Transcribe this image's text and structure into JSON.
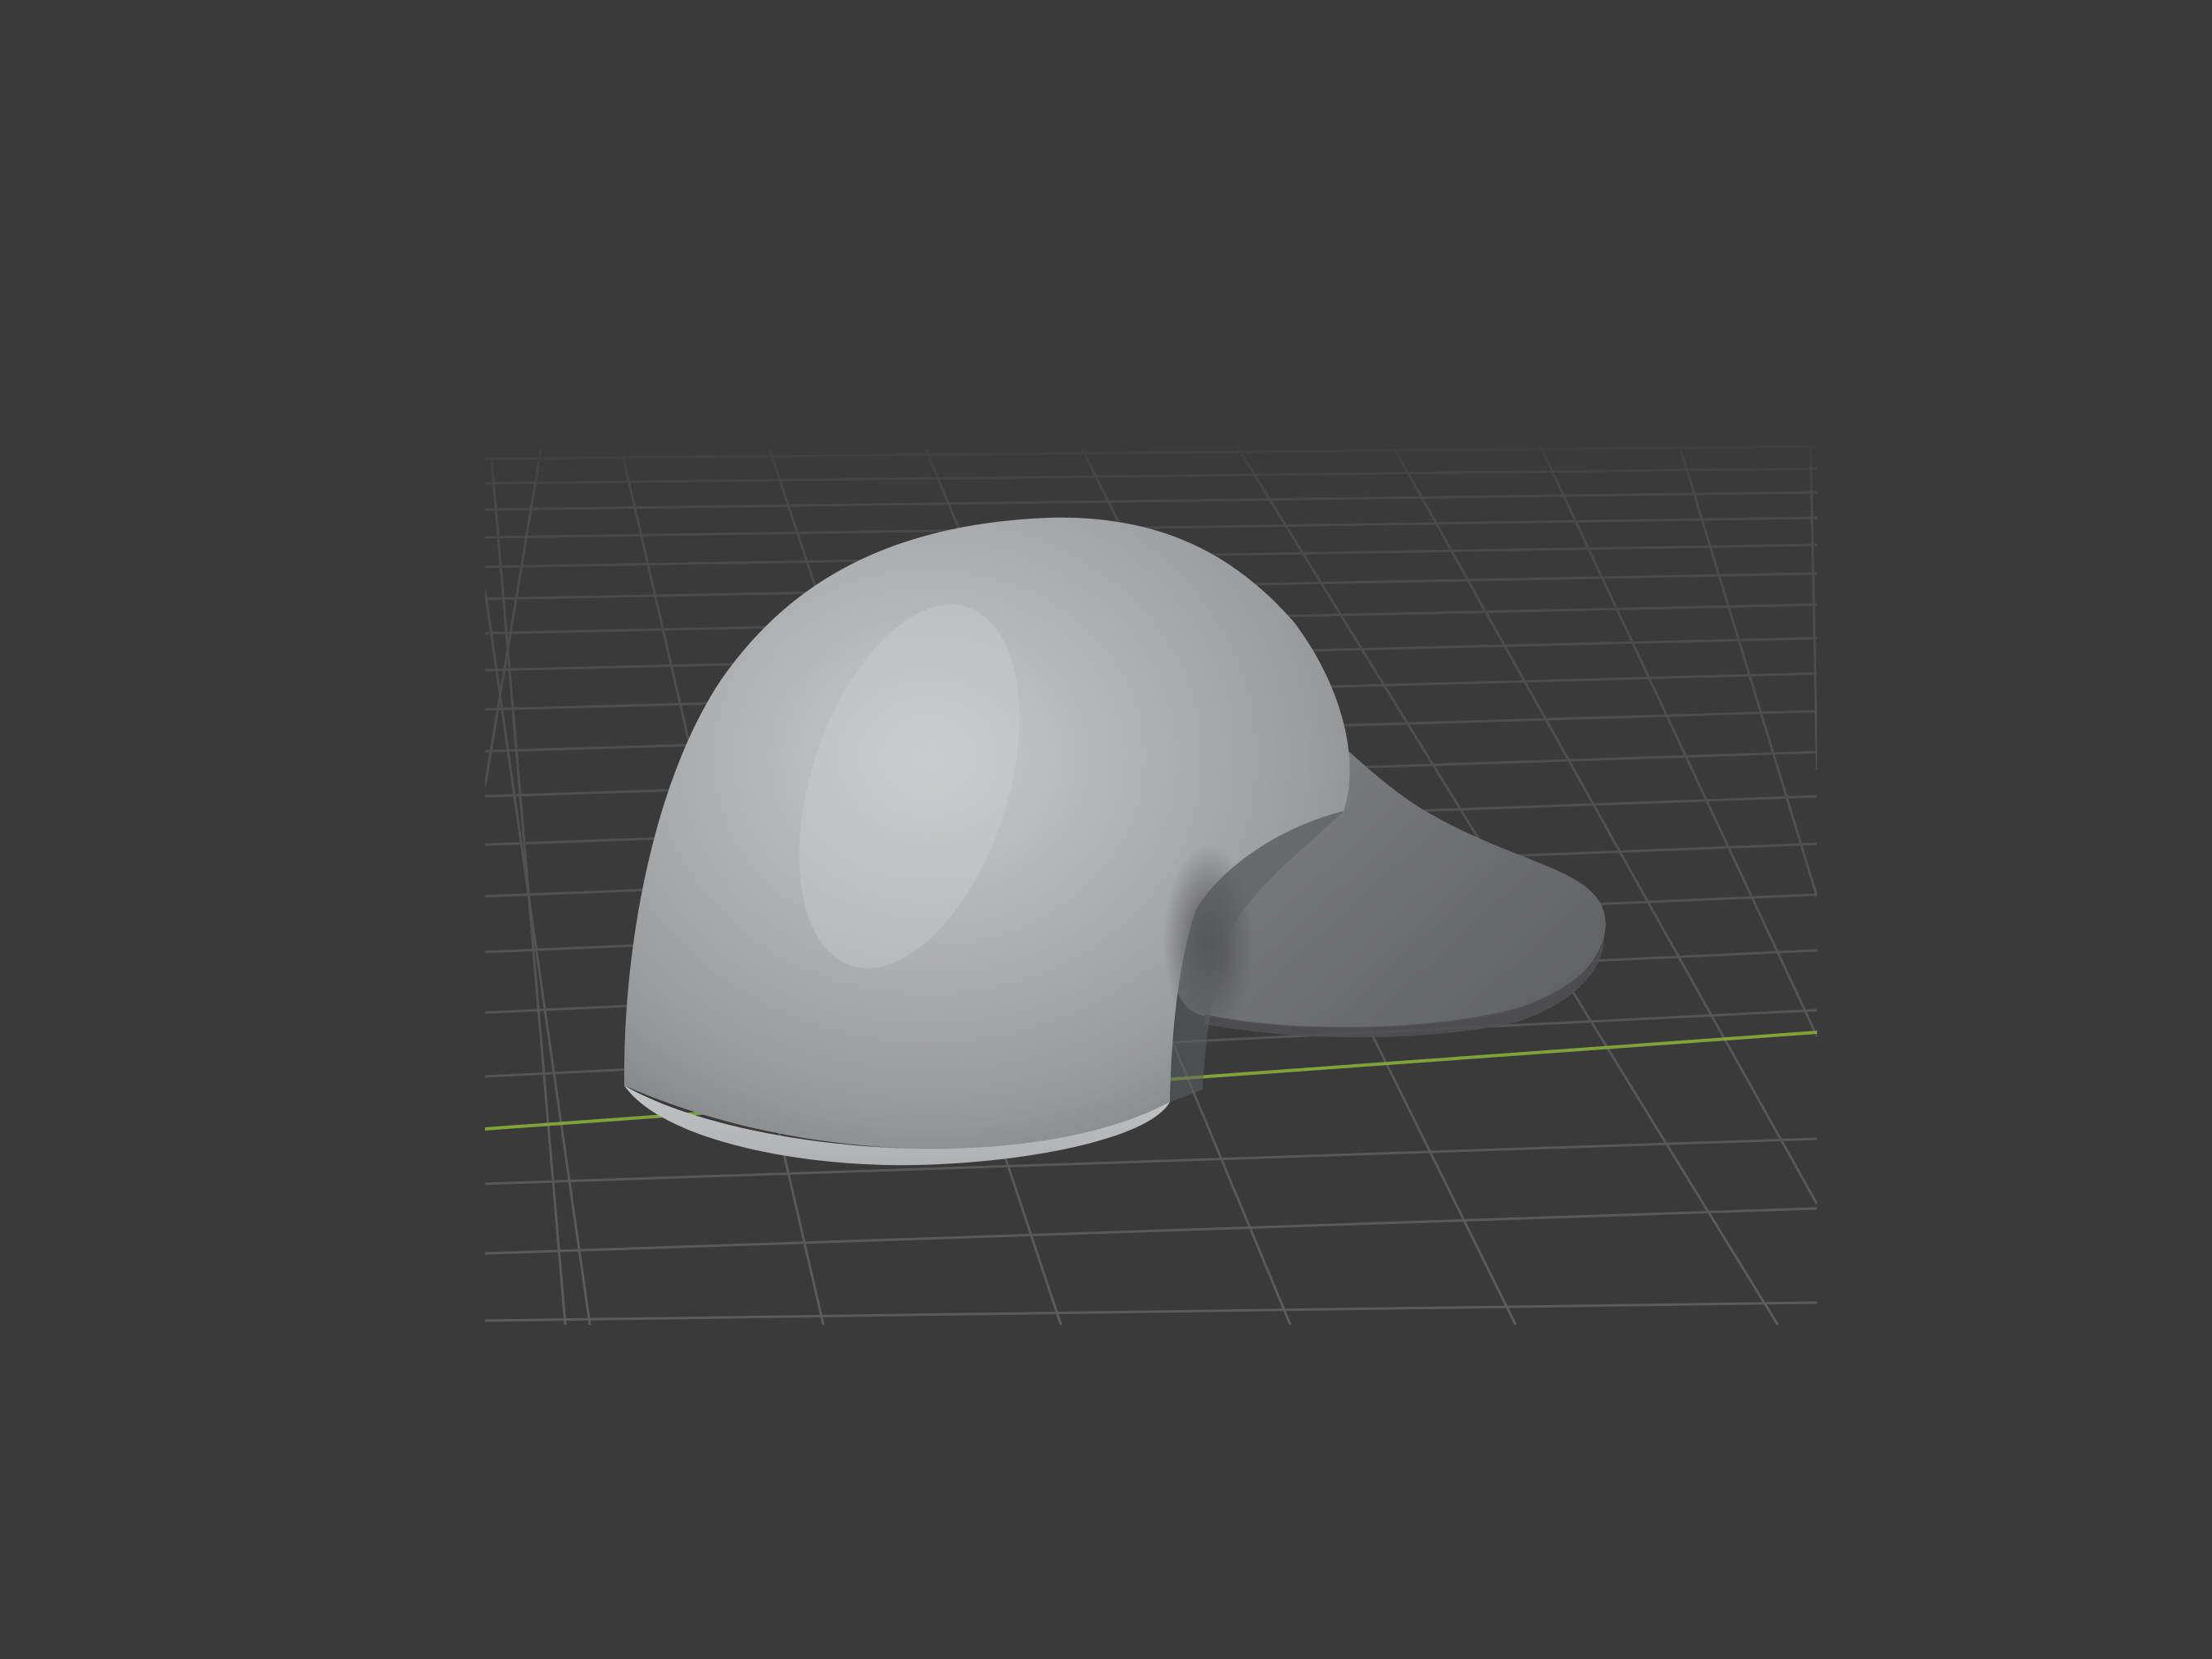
{
  "viewport": {
    "background_color": "#3a3a3a",
    "grid_line_color": "#595959",
    "x_axis_color": "#7fa336",
    "object_light_color": "#c8c9cb",
    "object_mid_color": "#9c9c9c",
    "object_shadow_color": "#5f5f5f",
    "grid_visible": true,
    "x_axis_visible": true,
    "object_shape": "smooth organic mesh (sculpted blob)"
  }
}
